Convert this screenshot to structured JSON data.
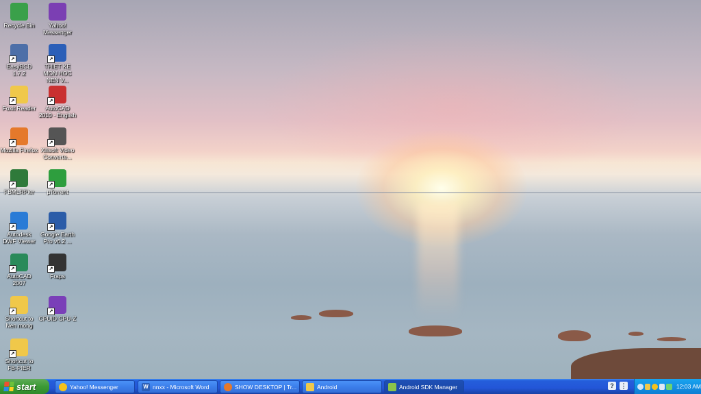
{
  "desktop_icons": [
    {
      "label": "Recycle Bin",
      "icon": "recycle-bin-icon",
      "color": "#3aa04a"
    },
    {
      "label": "Yahoo! Messenger",
      "icon": "yahoo-messenger-icon",
      "color": "#7b3fb3"
    },
    {
      "label": "EasyBCD 1.7.2",
      "icon": "easybcd-icon",
      "color": "#4d6fa8"
    },
    {
      "label": "THIET KE MON HOC NEN V...",
      "icon": "word-document-icon",
      "color": "#2b5fb8"
    },
    {
      "label": "Foxit Reader",
      "icon": "folder-icon",
      "color": "#f0c84a"
    },
    {
      "label": "AutoCAD 2010 - English",
      "icon": "autocad-2010-icon",
      "color": "#c93030"
    },
    {
      "label": "Mozilla Firefox",
      "icon": "firefox-icon",
      "color": "#e5792b"
    },
    {
      "label": "Xilisoft Video Converte...",
      "icon": "video-converter-icon",
      "color": "#555555"
    },
    {
      "label": "FBMLRPier",
      "icon": "fbml-icon",
      "color": "#2f7a3a"
    },
    {
      "label": "µTorrent",
      "icon": "utorrent-icon",
      "color": "#2e9e3e"
    },
    {
      "label": "Autodesk DWF Viewer",
      "icon": "dwf-viewer-icon",
      "color": "#2a7bd6"
    },
    {
      "label": "Google Earth Pro v6.2 ...",
      "icon": "google-earth-icon",
      "color": "#2b5ca8"
    },
    {
      "label": "AutoCAD 2007",
      "icon": "autocad-2007-icon",
      "color": "#2a8a5a"
    },
    {
      "label": "Fraps",
      "icon": "fraps-icon",
      "color": "#333333"
    },
    {
      "label": "Shortcut to Nen mong",
      "icon": "folder-icon",
      "color": "#f0c84a"
    },
    {
      "label": "CPUID CPU-Z",
      "icon": "cpuz-icon",
      "color": "#7a3fb8"
    },
    {
      "label": "Shortcut to FB-PIER",
      "icon": "folder-icon",
      "color": "#f0c84a"
    }
  ],
  "taskbar": {
    "start_label": "start",
    "tasks": [
      {
        "label": "Yahoo! Messenger",
        "icon": "yahoo-messenger-icon",
        "color": "#f5c21b"
      },
      {
        "label": "nnxx - Microsoft Word",
        "icon": "word-icon",
        "color": "#2b5fb8"
      },
      {
        "label": "SHOW DESKTOP | Tr...",
        "icon": "firefox-icon",
        "color": "#e5792b"
      },
      {
        "label": "Android",
        "icon": "folder-icon",
        "color": "#f0c84a"
      },
      {
        "label": "Android SDK Manager",
        "icon": "android-sdk-icon",
        "color": "#8bc34a"
      }
    ],
    "clock": "12:03 AM"
  }
}
